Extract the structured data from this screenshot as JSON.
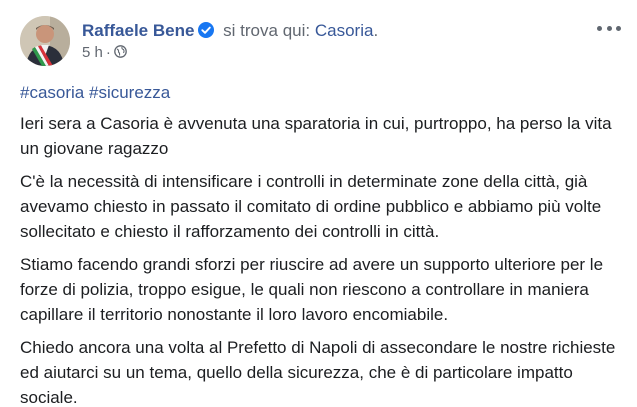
{
  "post": {
    "author": {
      "name": "Raffaele Bene",
      "location_prefix": "si trova qui:",
      "location": "Casoria",
      "location_suffix": "."
    },
    "timestamp": "5 h",
    "separator": "·",
    "hashtags": [
      "#casoria",
      "#sicurezza"
    ],
    "paragraphs": [
      "Ieri sera a Casoria è avvenuta una sparatoria in cui, purtroppo, ha perso la vita un giovane ragazzo",
      "C'è la necessità di intensificare i controlli in determinate zone della città, già avevamo chiesto in passato il comitato di ordine pubblico e abbiamo più volte sollecitato e chiesto il rafforzamento dei controlli in città.",
      "Stiamo facendo grandi sforzi per riuscire ad avere un supporto ulteriore per le forze di polizia, troppo esigue, le quali non riescono a controllare in maniera capillare il territorio nonostante il loro lavoro encomiabile.",
      "Chiedo ancora una volta al Prefetto di Napoli di assecondare le nostre richieste ed aiutarci su un tema, quello della sicurezza, che è di particolare impatto sociale."
    ]
  },
  "icons": {
    "verified": "verified-badge-icon",
    "audience": "globe-icon",
    "more": "more-options-icon"
  },
  "colors": {
    "link": "#385898",
    "text": "#1c1e21",
    "muted": "#616770",
    "verified": "#1877f2"
  }
}
